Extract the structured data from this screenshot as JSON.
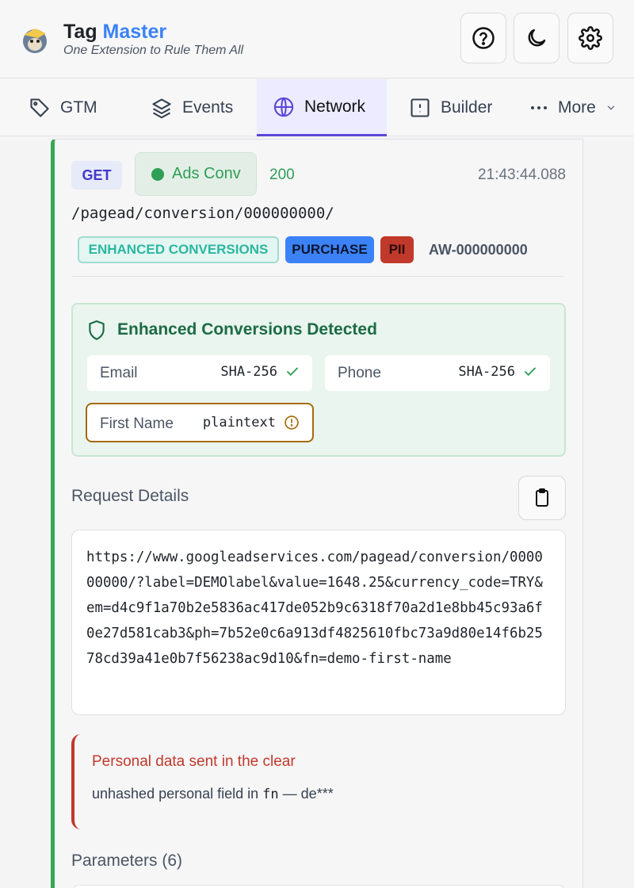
{
  "app": {
    "title_part1": "Tag",
    "title_part2": "Master",
    "tagline": "One Extension to Rule Them All",
    "accent_color": "#3b82f6",
    "header_buttons": [
      "help-icon",
      "moon-icon",
      "gear-icon"
    ]
  },
  "tabs": [
    {
      "label": "GTM",
      "icon": "tag-icon",
      "active": false
    },
    {
      "label": "Events",
      "icon": "layers-icon",
      "active": false
    },
    {
      "label": "Network",
      "icon": "globe-icon",
      "active": true
    },
    {
      "label": "Builder",
      "icon": "builder-icon",
      "active": false
    },
    {
      "label": "More",
      "icon": "ellipsis-icon",
      "active": false
    }
  ],
  "request": {
    "method": "GET",
    "tag_label": "Ads Conv",
    "status_code": "200",
    "time": "21:43:44.088",
    "path": "/pagead/conversion/000000000/",
    "badges": [
      "ENHANCED CONVERSIONS",
      "PURCHASE",
      "PII"
    ],
    "account_id": "AW-000000000",
    "status_color": "#2f9e57"
  },
  "enhanced": {
    "title": "Enhanced Conversions Detected",
    "fields": [
      {
        "label": "Email",
        "value": "SHA-256",
        "state": "hashed"
      },
      {
        "label": "Phone",
        "value": "SHA-256",
        "state": "hashed"
      },
      {
        "label": "First Name",
        "value": "plaintext",
        "state": "warning"
      }
    ]
  },
  "details": {
    "label": "Request Details",
    "url": "https://www.googleadservices.com/pagead/conversion/000000000/?label=DEMOlabel&value=1648.25&currency_code=TRY&em=d4c9f1a70b2e5836ac417de052b9c6318f70a2d1e8bb45c93a6f0e27d581cab3&ph=7b52e0c6a913df4825610fbc73a9d80e14f6b2578cd39a41e0b7f56238ac9d10&fn=demo-first-name"
  },
  "alert": {
    "title": "Personal data sent in the clear",
    "body_prefix": "unhashed personal field in",
    "field": "fn",
    "body_suffix": "— de***",
    "color": "#c0392b"
  },
  "parameters": {
    "label": "Parameters (6)"
  }
}
